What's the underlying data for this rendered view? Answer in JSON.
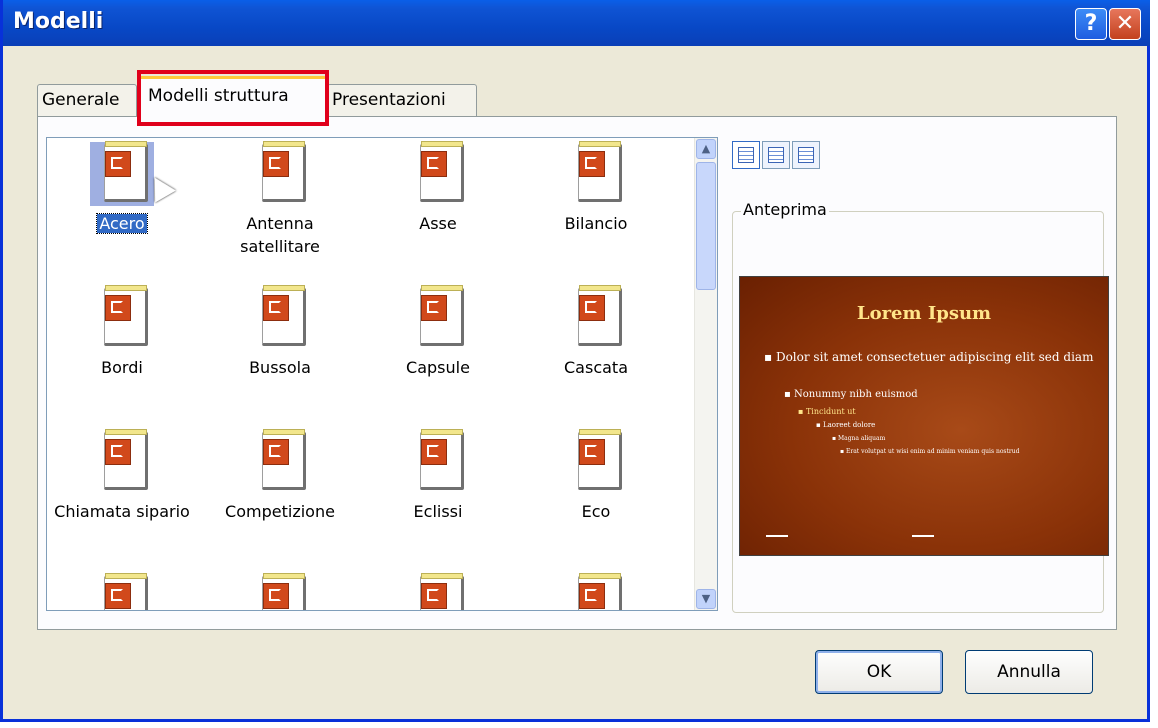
{
  "window": {
    "title": "Modelli",
    "help_label": "?",
    "close_label": "✕"
  },
  "tabs": [
    {
      "label": "Generale"
    },
    {
      "label": "Modelli struttura"
    },
    {
      "label": "Presentazioni"
    }
  ],
  "templates": [
    {
      "label": "Acero",
      "selected": true
    },
    {
      "label": "Antenna satellitare"
    },
    {
      "label": "Asse"
    },
    {
      "label": "Bilancio"
    },
    {
      "label": "Bordi"
    },
    {
      "label": "Bussola"
    },
    {
      "label": "Capsule"
    },
    {
      "label": "Cascata"
    },
    {
      "label": "Chiamata sipario"
    },
    {
      "label": "Competizione"
    },
    {
      "label": "Eclissi"
    },
    {
      "label": "Eco"
    }
  ],
  "view_buttons": [
    {
      "icon": "large-icons-view-icon"
    },
    {
      "icon": "list-view-icon"
    },
    {
      "icon": "details-view-icon"
    }
  ],
  "preview": {
    "legend": "Anteprima",
    "title": "Lorem Ipsum",
    "bullet1": "Dolor sit amet consectetuer adipiscing elit sed diam",
    "bullet2": "Nonummy nibh euismod",
    "bullet3": "Tincidunt ut",
    "bullet4": "Laoreet dolore",
    "bullet5": "Magna aliquam",
    "bullet6": "Erat volutpat ut wisi enim ad minim veniam quis nostrud"
  },
  "buttons": {
    "ok": "OK",
    "cancel": "Annulla"
  },
  "colors": {
    "titlebar": "#0a4ed2",
    "highlight": "#e0001b",
    "selection": "#316ac5",
    "template_badge": "#d1491b"
  }
}
